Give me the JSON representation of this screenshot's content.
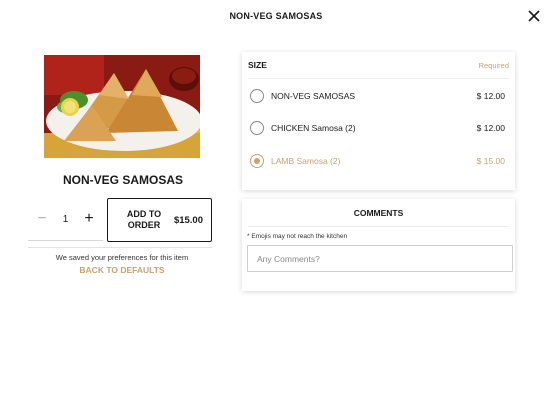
{
  "header": {
    "title": "NON-VEG SAMOSAS"
  },
  "icons": {
    "close": "close-icon",
    "image": "food-photo",
    "minus": "minus-icon",
    "plus": "plus-icon"
  },
  "product": {
    "name": "NON-VEG SAMOSAS",
    "image_alt": "samosas-photo"
  },
  "quantity": {
    "minus_label": "−",
    "value": "1",
    "plus_label": "+"
  },
  "add_to_order": {
    "label": "ADD TO ORDER",
    "price": "$15.00"
  },
  "preferences": {
    "note": "We saved your preferences for this item",
    "back_to_defaults": "BACK TO DEFAULTS"
  },
  "size": {
    "title": "SIZE",
    "required_label": "Required",
    "options": [
      {
        "label": "NON-VEG SAMOSAS",
        "price": "$ 12.00",
        "selected": false
      },
      {
        "label": "CHICKEN Samosa (2)",
        "price": "$ 12.00",
        "selected": false
      },
      {
        "label": "LAMB Samosa (2)",
        "price": "$ 15.00",
        "selected": true
      }
    ]
  },
  "comments": {
    "title": "COMMENTS",
    "emoji_note": "* Emojis may not reach the kitchen",
    "placeholder": "Any Comments?",
    "value": ""
  },
  "colors": {
    "accent": "#c8a36f",
    "text": "#1a1a1a",
    "muted": "#b5b5b5"
  }
}
